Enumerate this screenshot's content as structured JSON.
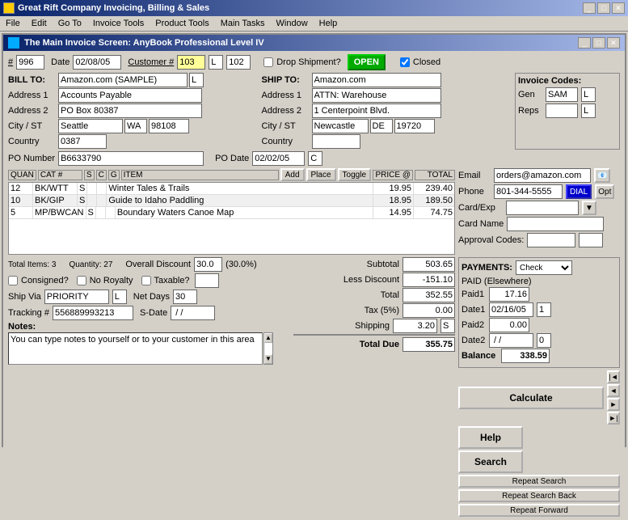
{
  "app": {
    "title": "Great Rift Company Invoicing, Billing & Sales",
    "main_window_title": "The Main Invoice Screen: AnyBook Professional Level IV"
  },
  "menu": {
    "items": [
      "File",
      "Edit",
      "Go To",
      "Invoice Tools",
      "Product Tools",
      "Main Tasks",
      "Window",
      "Help"
    ]
  },
  "header": {
    "invoice_num_label": "#",
    "invoice_num": "996",
    "date_label": "Date",
    "date": "02/08/05",
    "customer_label": "Customer #",
    "customer_num": "103",
    "customer_code": "L",
    "customer_id": "102",
    "drop_shipment_label": "Drop Shipment?",
    "open_btn": "OPEN",
    "closed_label": "Closed",
    "closed_checked": true
  },
  "bill_to": {
    "label": "BILL TO:",
    "name": "Amazon.com (SAMPLE)",
    "name_code": "L",
    "address1_label": "Address 1",
    "address1": "Accounts Payable",
    "address2_label": "Address 2",
    "address2": "PO Box 80387",
    "city_st_label": "City / ST",
    "city": "Seattle",
    "state": "WA",
    "zip": "98108",
    "country_label": "Country",
    "country_code": "0387"
  },
  "ship_to": {
    "label": "SHIP TO:",
    "name": "Amazon.com",
    "address1_label": "Address 1",
    "address1": "ATTN: Warehouse",
    "address2_label": "Address 2",
    "address2": "1 Centerpoint Blvd.",
    "city_st_label": "City / ST",
    "city": "Newcastle",
    "state": "DE",
    "zip": "19720",
    "country_label": "Country",
    "country": ""
  },
  "invoice_codes": {
    "label": "Invoice Codes:",
    "gen_label": "Gen",
    "gen_code": "SAM",
    "reps_label": "Reps",
    "reps_code": ""
  },
  "po": {
    "po_number_label": "PO Number",
    "po_number": "B6633790",
    "po_date_label": "PO Date",
    "po_date": "02/02/05",
    "po_date_code": "C"
  },
  "table": {
    "headers": [
      "QUAN",
      "CAT #",
      "S",
      "C",
      "G",
      "ITEM",
      "",
      "",
      "",
      "PRICE @",
      "TOTAL"
    ],
    "buttons": [
      "Add",
      "Place",
      "Toggle"
    ],
    "rows": [
      {
        "quan": "12",
        "cat": "BK/WTT",
        "s": "S",
        "c": "",
        "g": "",
        "item": "Winter Tales & Trails",
        "price": "19.95",
        "total": "239.40"
      },
      {
        "quan": "10",
        "cat": "BK/GIP",
        "s": "S",
        "c": "",
        "g": "",
        "item": "Guide to Idaho Paddling",
        "price": "18.95",
        "total": "189.50"
      },
      {
        "quan": "5",
        "cat": "MP/BWCAN",
        "s": "S",
        "c": "",
        "g": "",
        "item": "Boundary Waters Canoe Map",
        "price": "14.95",
        "total": "74.75"
      }
    ]
  },
  "summary": {
    "total_items_label": "Total Items: 3",
    "quantity_label": "Quantity: 27",
    "overall_discount_label": "Overall Discount",
    "overall_discount": "30.0",
    "discount_pct": "(30.0%)",
    "consigned_label": "Consigned?",
    "no_royalty_label": "No Royalty",
    "taxable_label": "Taxable?",
    "ship_via_label": "Ship Via",
    "ship_via": "PRIORITY",
    "ship_code": "L",
    "net_days_label": "Net Days",
    "net_days": "30",
    "tracking_label": "Tracking #",
    "tracking": "556889993213",
    "sdate_label": "S-Date",
    "sdate": " / /"
  },
  "totals": {
    "subtotal_label": "Subtotal",
    "subtotal": "503.65",
    "less_discount_label": "Less Discount",
    "less_discount": "-151.10",
    "total_label": "Total",
    "total": "352.55",
    "tax_label": "Tax (5%)",
    "tax": "0.00",
    "shipping_label": "Shipping",
    "shipping": "3.20",
    "shipping_code": "S",
    "total_due_label": "Total Due",
    "total_due": "355.75"
  },
  "contact": {
    "email_label": "Email",
    "email": "orders@amazon.com",
    "phone_label": "Phone",
    "phone": "801-344-5555",
    "dial_btn": "DIAL",
    "opt_btn": "Opt",
    "card_exp_label": "Card/Exp",
    "card_name_label": "Card Name",
    "approval_label": "Approval Codes:"
  },
  "payments": {
    "label": "PAYMENTS:",
    "type": "Check",
    "paid_elsewhere_label": "PAID (Elsewhere)",
    "paid1_label": "Paid1",
    "paid1": "17.16",
    "date1_label": "Date1",
    "date1": "02/16/05",
    "date1_code": "1",
    "paid2_label": "Paid2",
    "paid2": "0.00",
    "date2_label": "Date2",
    "date2": " / /",
    "date2_code": "0",
    "balance_label": "Balance",
    "balance": "338.59"
  },
  "buttons": {
    "calculate": "Calculate",
    "help": "Help",
    "search": "Search",
    "repeat_search": "Repeat Search",
    "repeat_search_back": "Repeat Search Back",
    "repeat_forward": "Repeat Forward"
  },
  "notes": {
    "label": "Notes:",
    "text": "You can type notes to yourself or to your customer in this area"
  }
}
